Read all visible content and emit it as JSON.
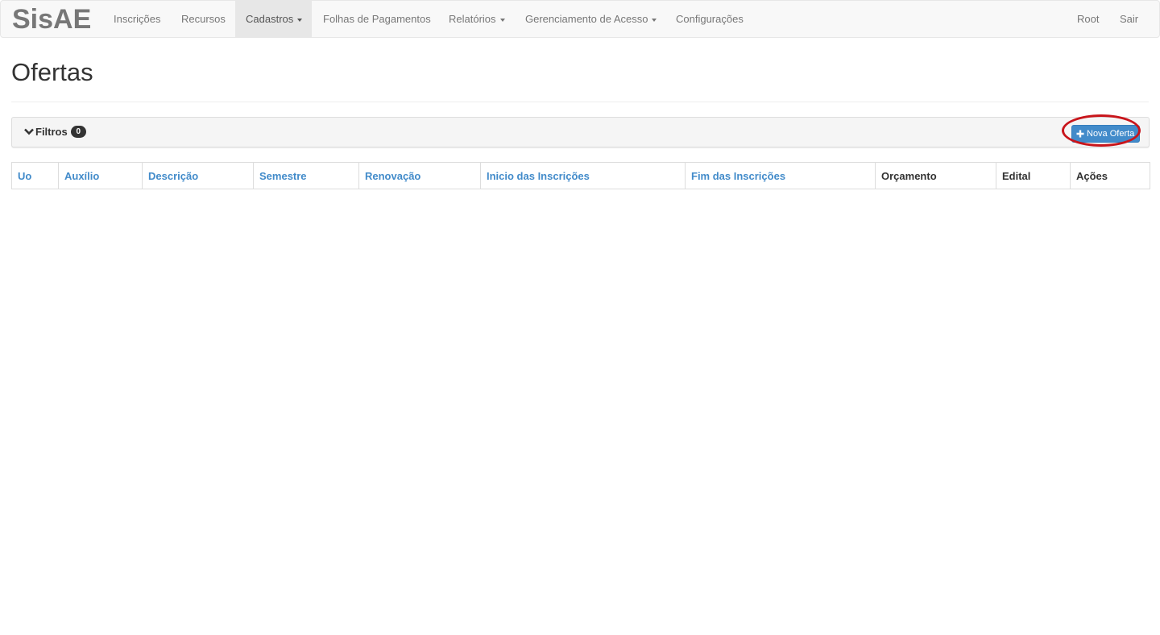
{
  "navbar": {
    "brand": "SisAE",
    "items": [
      {
        "label": "Inscrições",
        "dropdown": false,
        "active": false
      },
      {
        "label": "Recursos",
        "dropdown": false,
        "active": false
      },
      {
        "label": "Cadastros",
        "dropdown": true,
        "active": true
      },
      {
        "label": "Folhas de Pagamentos",
        "dropdown": false,
        "active": false
      },
      {
        "label": "Relatórios",
        "dropdown": true,
        "active": false
      },
      {
        "label": "Gerenciamento de Acesso",
        "dropdown": true,
        "active": false
      },
      {
        "label": "Configurações",
        "dropdown": false,
        "active": false
      }
    ],
    "right_items": [
      {
        "label": "Root"
      },
      {
        "label": "Sair"
      }
    ]
  },
  "page": {
    "title": "Ofertas"
  },
  "filters": {
    "label": "Filtros",
    "count": "0",
    "toggle_icon": "chevron-down-icon"
  },
  "toolbar": {
    "new_label": "Nova Oferta",
    "new_icon": "plus-icon"
  },
  "table": {
    "columns": [
      {
        "label": "Uo",
        "sortable": true
      },
      {
        "label": "Auxílio",
        "sortable": true
      },
      {
        "label": "Descrição",
        "sortable": true
      },
      {
        "label": "Semestre",
        "sortable": true
      },
      {
        "label": "Renovação",
        "sortable": true
      },
      {
        "label": "Inicio das Inscrições",
        "sortable": true
      },
      {
        "label": "Fim das Inscrições",
        "sortable": true
      },
      {
        "label": "Orçamento",
        "sortable": false
      },
      {
        "label": "Edital",
        "sortable": false
      },
      {
        "label": "Ações",
        "sortable": false
      }
    ],
    "rows": []
  },
  "colors": {
    "link": "#428bca",
    "primary_button": "#428bca",
    "highlight_ring": "#c8151b",
    "navbar_bg": "#f8f8f8"
  }
}
